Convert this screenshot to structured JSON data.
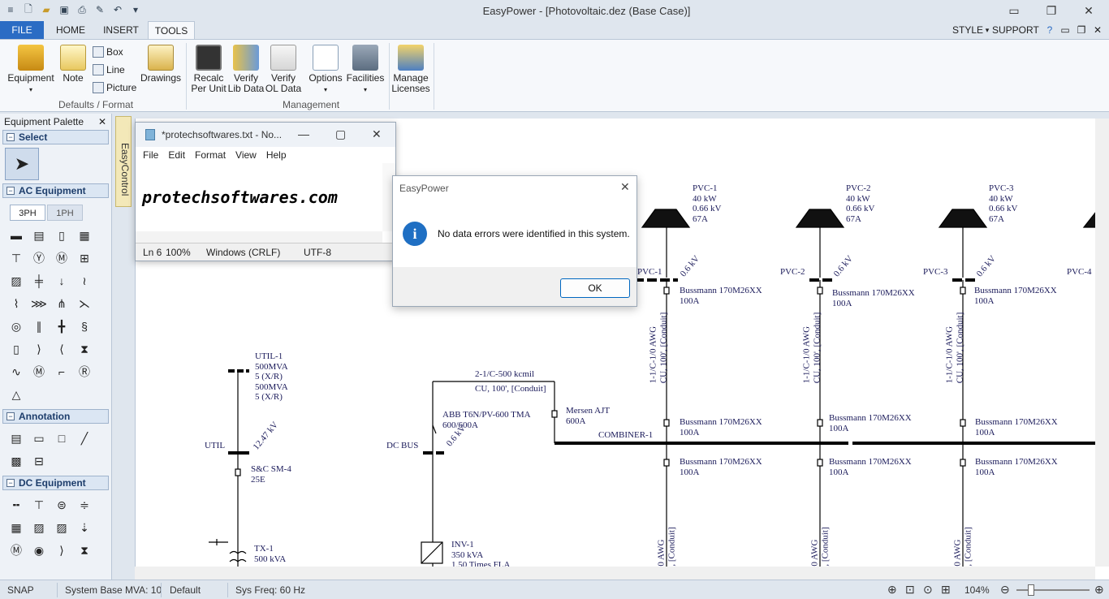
{
  "app": {
    "title": "EasyPower - [Photovoltaic.dez  (Base Case)]",
    "style_label": "STYLE",
    "support_label": "SUPPORT"
  },
  "ribbon_tabs": [
    "FILE",
    "HOME",
    "INSERT",
    "TOOLS"
  ],
  "ribbon": {
    "equipment": "Equipment",
    "note": "Note",
    "box": "Box",
    "line": "Line",
    "picture": "Picture",
    "drawings": "Drawings",
    "group_defaults": "Defaults / Format",
    "recalc": "Recalc",
    "per_unit": "Per Unit",
    "verify1": "Verify",
    "lib_data": "Lib Data",
    "verify2": "Verify",
    "ol_data": "OL Data",
    "options": "Options",
    "facilities": "Facilities",
    "manage": "Manage",
    "licenses": "Licenses",
    "group_management": "Management"
  },
  "palette": {
    "title": "Equipment Palette",
    "select": "Select",
    "ac_equipment": "AC Equipment",
    "tab_3ph": "3PH",
    "tab_1ph": "1PH",
    "annotation": "Annotation",
    "dc_equipment": "DC Equipment"
  },
  "side_tab": "EasyControl",
  "notepad": {
    "title": "*protechsoftwares.txt - No...",
    "menu": [
      "File",
      "Edit",
      "Format",
      "View",
      "Help"
    ],
    "content": "protechsoftwares.com",
    "status_ln": "Ln 6",
    "status_zoom": "100%",
    "status_eol": "Windows (CRLF)",
    "status_enc": "UTF-8"
  },
  "dialog": {
    "title": "EasyPower",
    "message": "No data errors were identified in this system.",
    "ok": "OK"
  },
  "oneline": {
    "pvc": [
      {
        "name": "PVC-1",
        "kw": "40 kW",
        "kv": "0.66 kV",
        "amps": "67A",
        "bus": "PVC-1"
      },
      {
        "name": "PVC-2",
        "kw": "40 kW",
        "kv": "0.66 kV",
        "amps": "67A",
        "bus": "PVC-2"
      },
      {
        "name": "PVC-3",
        "kw": "40 kW",
        "kv": "0.66 kV",
        "amps": "67A",
        "bus": "PVC-3"
      }
    ],
    "pvc4_bus": "PVC-4",
    "bus_kv": "0.6 kV",
    "fuse_name": "Bussmann 170M26XX",
    "fuse_amp": "100A",
    "cable_a": "1-1/C-1/0 AWG",
    "cable_b": "CU, 100', [Conduit]",
    "util": [
      "UTIL-1",
      "500MVA",
      "5 (X/R)",
      "500MVA",
      "5 (X/R)"
    ],
    "util_bus": "UTIL",
    "util_kv": "12.47 kV",
    "sc_fuse": [
      "S&C SM-4",
      "25E"
    ],
    "tx": [
      "TX-1",
      "500 kVA"
    ],
    "dc_bus": "DC BUS",
    "dc_kv": "0.6 kV",
    "dc_cable": [
      "2-1/C-500 kcmil",
      "CU, 100', [Conduit]"
    ],
    "abb": [
      "ABB  T6N/PV-600 TMA",
      "600/600A"
    ],
    "mersen": [
      "Mersen AJT",
      "600A"
    ],
    "combiner": "COMBINER-1",
    "inv": [
      "INV-1",
      "350 kVA",
      "1.50 Times FLA"
    ],
    "cable_bottom_a": "0 AWG",
    "cable_bottom_b": ", [Conduit]"
  },
  "status": {
    "snap": "SNAP",
    "base_mva": "System Base MVA: 10",
    "default": "Default",
    "freq": "Sys Freq: 60 Hz",
    "zoom": "104%"
  }
}
